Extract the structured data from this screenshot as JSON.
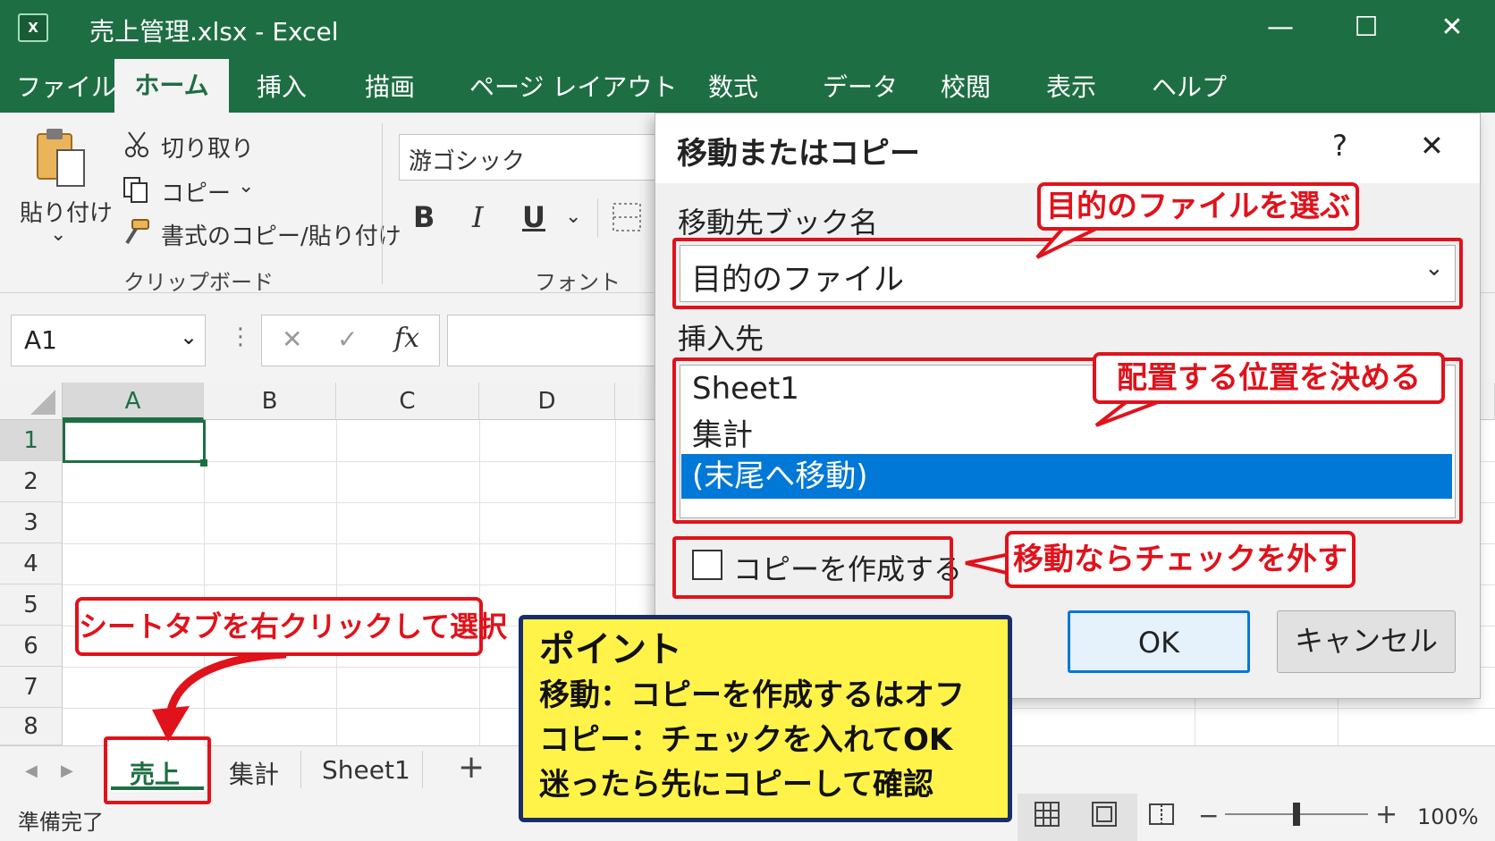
{
  "window": {
    "title": "売上管理.xlsx  -  Excel",
    "app_icon_label": "X",
    "minimize": "—",
    "maximize": "☐",
    "close": "✕"
  },
  "ribbon_tabs": [
    "ファイル",
    "ホーム",
    "挿入",
    "描画",
    "ページ レイアウト",
    "数式",
    "データ",
    "校閲",
    "表示",
    "ヘルプ"
  ],
  "ribbon": {
    "paste_label": "貼り付け",
    "paste_chevron": "⌄",
    "cut": "切り取り",
    "copy": "コピー",
    "copy_chevron": "⌄",
    "format_painter": "書式のコピー/貼り付け",
    "clipboard_group": "クリップボード",
    "font_name": "游ゴシック",
    "bold": "B",
    "italic": "I",
    "underline": "U",
    "underline_chevron": "⌄",
    "font_group": "フォント"
  },
  "formula_bar": {
    "name_box": "A1",
    "name_chevron": "⌄",
    "dots": "⋮",
    "cancel": "✕",
    "enter": "✓",
    "fx": "fx"
  },
  "grid": {
    "columns": [
      "A",
      "B",
      "C",
      "D"
    ],
    "rows": [
      "1",
      "2",
      "3",
      "4",
      "5",
      "6",
      "7",
      "8"
    ]
  },
  "sheet_tabs": {
    "prev": "◀",
    "next": "▶",
    "tabs": [
      "売上",
      "集計",
      "Sheet1"
    ],
    "add": "+"
  },
  "status_bar": {
    "status": "準備完了",
    "zoom_minus": "−",
    "zoom_plus": "+",
    "zoom": "100%",
    "zoom_level_percent": 100
  },
  "dialog": {
    "title": "移動またはコピー",
    "help": "?",
    "close": "✕",
    "book_label": "移動先ブック名",
    "book_value": "目的のファイル",
    "book_chevron": "⌄",
    "insert_label": "挿入先",
    "list_items": [
      "Sheet1",
      "集計",
      "(末尾へ移動)"
    ],
    "selected_index": 2,
    "checkbox_label": "コピーを作成する",
    "checkbox_checked": false,
    "ok": "OK",
    "cancel": "キャンセル"
  },
  "annotations": {
    "callout_file": "目的のファイルを選ぶ",
    "callout_position": "配置する位置を決める",
    "callout_check": "移動ならチェックを外す",
    "callout_tab": "シートタブを右クリックして選択",
    "point_title": "ポイント",
    "point_lines": [
      "移動：コピーを作成するはオフ",
      "コピー：チェックを入れてOK",
      "迷ったら先にコピーして確認"
    ]
  },
  "colors": {
    "excel_green": "#1e6e43",
    "annotation_red": "#e0121b",
    "point_yellow": "#fff34a",
    "point_border": "#1a2d6b",
    "selection_blue": "#0078d7"
  }
}
